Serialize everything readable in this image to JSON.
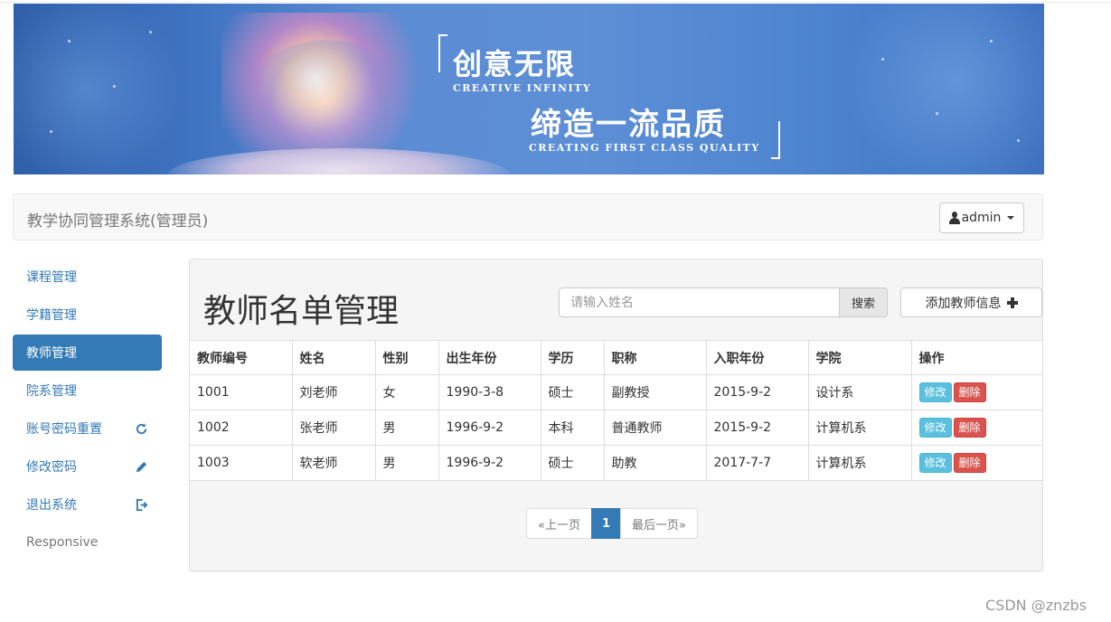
{
  "banner": {
    "headline1": "创意无限",
    "subline1": "CREATIVE INFINITY",
    "headline2": "缔造一流品质",
    "subline2": "CREATING FIRST CLASS QUALITY"
  },
  "navbar": {
    "brand": "教学协同管理系统(管理员)",
    "user_label": "admin"
  },
  "sidebar": {
    "items": [
      {
        "label": "课程管理",
        "icon": ""
      },
      {
        "label": "学籍管理",
        "icon": ""
      },
      {
        "label": "教师管理",
        "icon": "",
        "active": true
      },
      {
        "label": "院系管理",
        "icon": ""
      },
      {
        "label": "账号密码重置",
        "icon": "refresh-icon"
      },
      {
        "label": "修改密码",
        "icon": "pencil-icon"
      },
      {
        "label": "退出系统",
        "icon": "logout-icon"
      },
      {
        "label": "Responsive",
        "icon": ""
      }
    ]
  },
  "main": {
    "title": "教师名单管理",
    "search_placeholder": "请输入姓名",
    "search_button": "搜索",
    "add_button": "添加教师信息",
    "table": {
      "headers": [
        "教师编号",
        "姓名",
        "性别",
        "出生年份",
        "学历",
        "职称",
        "入职年份",
        "学院",
        "操作"
      ],
      "rows": [
        [
          "1001",
          "刘老师",
          "女",
          "1990-3-8",
          "硕士",
          "副教授",
          "2015-9-2",
          "设计系"
        ],
        [
          "1002",
          "张老师",
          "男",
          "1996-9-2",
          "本科",
          "普通教师",
          "2015-9-2",
          "计算机系"
        ],
        [
          "1003",
          "软老师",
          "男",
          "1996-9-2",
          "硕士",
          "助教",
          "2017-7-7",
          "计算机系"
        ]
      ],
      "edit_label": "修改",
      "delete_label": "删除"
    },
    "pagination": {
      "prev": "«上一页",
      "current": "1",
      "last": "最后一页»"
    }
  },
  "watermark": "CSDN @znzbs",
  "colors": {
    "primary": "#337ab7",
    "info": "#5bc0de",
    "danger": "#d9534f"
  }
}
